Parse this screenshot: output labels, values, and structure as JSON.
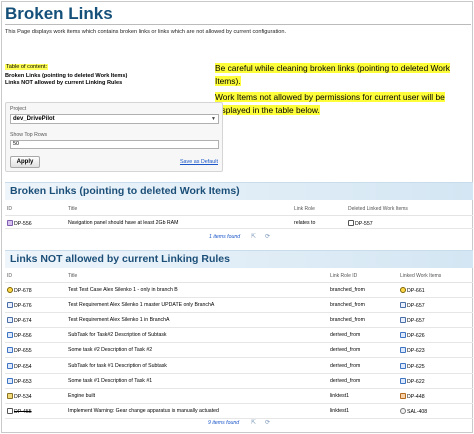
{
  "page": {
    "title": "Broken Links",
    "description": "This Page displays work items which contains broken links or links which are not allowed by current configuration."
  },
  "toc": {
    "heading": "Table of content:",
    "items": [
      "Broken Links (pointing to deleted Work Items)",
      "Links NOT allowed by current Linking Rules"
    ]
  },
  "warning": {
    "line1": "Be careful while cleaning broken links (pointing to deleted Work Items).",
    "line2": "Work Items not allowed by permissions for current user will be",
    "line3": "displayed in the table below."
  },
  "filter": {
    "project_label": "Project",
    "project_value": "dev_DrivePilot",
    "rows_label": "Show Top Rows",
    "rows_value": "50",
    "apply_label": "Apply",
    "save_default_label": "Save as Default"
  },
  "broken": {
    "title": "Broken Links (pointing to deleted Work Items)",
    "columns": {
      "id": "ID",
      "title": "Title",
      "role": "Link Role",
      "linked": "Deleted Linked Work Items"
    },
    "rows": [
      {
        "id": "DP-556",
        "icon": "user-story-icon",
        "title": "Navigation panel should have at least 2Gb RAM",
        "role": "relates to",
        "linked": "DP-557",
        "linked_icon": "document-icon"
      }
    ],
    "footer": "1 items found"
  },
  "notallowed": {
    "title": "Links NOT allowed by current Linking Rules",
    "columns": {
      "id": "ID",
      "title": "Title",
      "role": "Link Role ID",
      "linked": "Linked Work Items"
    },
    "rows": [
      {
        "id": "DP-678",
        "icon": "test-case-icon",
        "title": "Test Test Case Alex Silenko 1 - only in branch B",
        "role": "branched_from",
        "linked": "DP-661",
        "linked_icon": "test-case-icon"
      },
      {
        "id": "DP-676",
        "icon": "requirement-icon",
        "title": "Test Requirement Alex Silenko 1 master UPDATE only BranchA",
        "role": "branched_from",
        "linked": "DP-657",
        "linked_icon": "requirement-icon"
      },
      {
        "id": "DP-674",
        "icon": "requirement-icon",
        "title": "Test Requirement Alex Silenko 1 in BranchA",
        "role": "branched_from",
        "linked": "DP-657",
        "linked_icon": "requirement-icon"
      },
      {
        "id": "DP-656",
        "icon": "task-icon",
        "title": "SubTask for Task#2 Description of Subtask",
        "role": "derived_from",
        "linked": "DP-626",
        "linked_icon": "task-icon"
      },
      {
        "id": "DP-655",
        "icon": "task-icon",
        "title": "Some task #2 Description of Task #2",
        "role": "derived_from",
        "linked": "DP-623",
        "linked_icon": "task-icon"
      },
      {
        "id": "DP-654",
        "icon": "task-icon",
        "title": "SubTask for task #1 Description of Subtask",
        "role": "derived_from",
        "linked": "DP-625",
        "linked_icon": "task-icon"
      },
      {
        "id": "DP-653",
        "icon": "task-icon",
        "title": "Some task #1 Description of Task #1",
        "role": "derived_from",
        "linked": "DP-622",
        "linked_icon": "task-icon"
      },
      {
        "id": "DP-534",
        "icon": "build-icon",
        "title": "Engine built",
        "role": "linktest1",
        "linked": "DP-448",
        "linked_icon": "issue-icon"
      },
      {
        "id": "DP-455",
        "icon": "document-icon",
        "title": "Implement Warning: Gear change apparatus is manually actuated",
        "role": "linktest1",
        "linked": "SAL-408",
        "linked_icon": "safety-icon",
        "id_struck": true
      }
    ],
    "footer": "9 items found"
  }
}
